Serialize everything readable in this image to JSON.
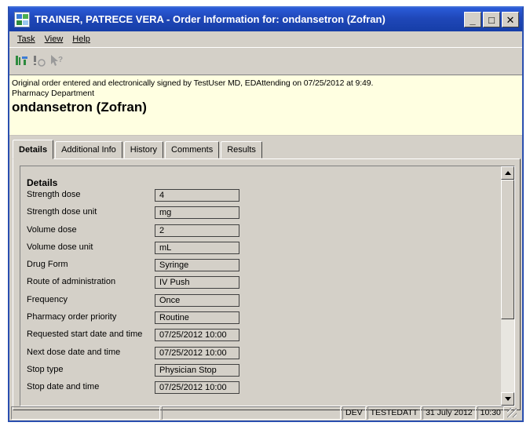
{
  "window": {
    "title": "TRAINER, PATRECE VERA - Order Information for:  ondansetron (Zofran)",
    "controls": {
      "minimize": "_",
      "maximize": "□",
      "close": "✕"
    }
  },
  "menu": [
    "Task",
    "View",
    "Help"
  ],
  "toolbar": {
    "icons": [
      "modify-order-icon",
      "alert-icon",
      "help-pointer-icon"
    ]
  },
  "banner": {
    "order_line": "Original order entered and electronically signed by TestUser MD, EDAttending on 07/25/2012 at 9:49.",
    "department": "Pharmacy Department",
    "drug": "ondansetron (Zofran)"
  },
  "tabs": [
    "Details",
    "Additional Info",
    "History",
    "Comments",
    "Results"
  ],
  "details": {
    "section_title": "Details",
    "fields": [
      {
        "label": "Strength dose",
        "value": "4"
      },
      {
        "label": "Strength dose unit",
        "value": "mg"
      },
      {
        "label": "Volume dose",
        "value": "2"
      },
      {
        "label": "Volume dose unit",
        "value": "mL"
      },
      {
        "label": "Drug Form",
        "value": "Syringe"
      },
      {
        "label": "Route of administration",
        "value": "IV Push"
      },
      {
        "label": "Frequency",
        "value": "Once"
      },
      {
        "label": "Pharmacy order priority",
        "value": "Routine"
      },
      {
        "label": "Requested start date and time",
        "value": "07/25/2012 10:00"
      },
      {
        "label": "Next dose date and time",
        "value": "07/25/2012 10:00"
      },
      {
        "label": "Stop type",
        "value": "Physician Stop"
      },
      {
        "label": "Stop date and time",
        "value": "07/25/2012 10:00"
      }
    ]
  },
  "status": {
    "env": "DEV",
    "user": "TESTEDATT",
    "date": "31 July 2012",
    "time": "10:30"
  },
  "colors": {
    "title_bar": "#1f47b8",
    "banner_bg": "#ffffe1",
    "chrome": "#d4d0c8"
  }
}
